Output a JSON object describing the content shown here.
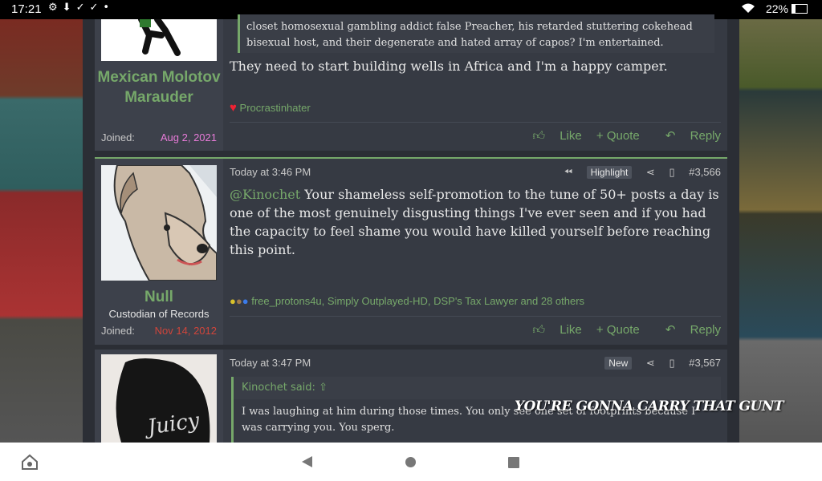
{
  "status_bar": {
    "time": "17:21",
    "battery": "22%",
    "battery_level": 0.22,
    "icons": [
      "gear-icon",
      "download-icon",
      "check-icon",
      "check-icon",
      "dot-icon"
    ]
  },
  "background_caption": "YOU'RE GONNA CARRY THAT GUNT",
  "posts": [
    {
      "username": "Mexican Molotov Marauder",
      "joined_label": "Joined:",
      "joined_date": "Aug 2, 2021",
      "quote_tail": "closet homosexual gambling addict false Preacher, his retarded stuttering cokehead bisexual host, and their degenerate and hated array of capos? I'm entertained.",
      "body": "They need to start building wells in Africa and I'm a happy camper.",
      "reactions": "Procrastinhater",
      "actions": {
        "like": "Like",
        "quote": "+ Quote",
        "reply": "Reply"
      }
    },
    {
      "username": "Null",
      "user_title": "Custodian of Records",
      "joined_label": "Joined:",
      "joined_date": "Nov 14, 2012",
      "timestamp": "Today at 3:46 PM",
      "badge": "Highlight",
      "post_number": "#3,566",
      "mention": "@Kinochet",
      "body": " Your shameless self-promotion to the tune of 50+ posts a day is one of the most genuinely disgusting things I've ever seen and if you had the capacity to feel shame you would have killed yourself before reaching this point.",
      "reactions": "free_protons4u, Simply Outplayed-HD, DSP's Tax Lawyer and 28 others",
      "actions": {
        "like": "Like",
        "quote": "+ Quote",
        "reply": "Reply"
      }
    },
    {
      "timestamp": "Today at 3:47 PM",
      "badge": "New",
      "post_number": "#3,567",
      "quote_author": "Kinochet said:",
      "quote_text": "I was laughing at him during those times. You only see one set of footprints because I was carrying you. You sperg."
    }
  ],
  "colors": {
    "accent": "#76a86a",
    "post_bg": "#363a43",
    "userbox_bg": "#3d414b",
    "joined_pink": "#e77bd8",
    "joined_red": "#d0453b"
  }
}
